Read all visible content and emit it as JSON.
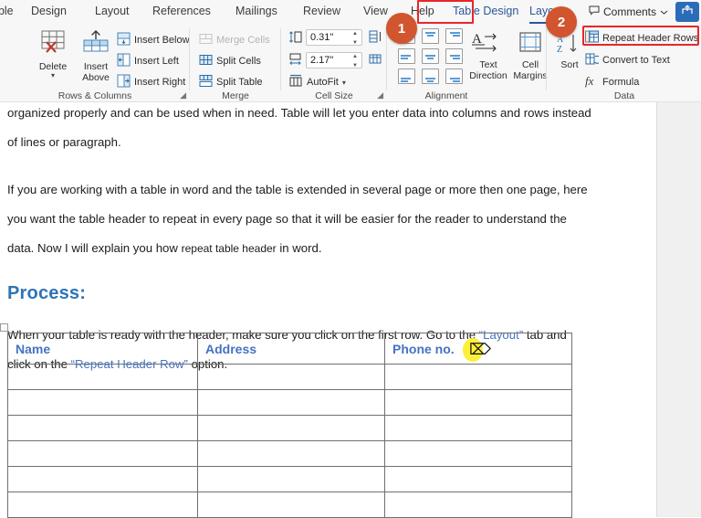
{
  "app": {
    "tabs": [
      {
        "label": "able",
        "state": "cut-off"
      },
      {
        "label": "Design",
        "state": "normal"
      },
      {
        "label": "Layout",
        "state": "normal"
      },
      {
        "label": "References",
        "state": "normal"
      },
      {
        "label": "Mailings",
        "state": "normal"
      },
      {
        "label": "Review",
        "state": "normal"
      },
      {
        "label": "View",
        "state": "normal"
      },
      {
        "label": "Help",
        "state": "normal"
      },
      {
        "label": "Table Design",
        "state": "contextual"
      },
      {
        "label": "Layout",
        "state": "active"
      }
    ],
    "comments_label": "Comments",
    "share_icon": "share-icon",
    "comments_icon": "comment-bubble-icon",
    "chevron_icon": "chevron-down-icon"
  },
  "ribbon": {
    "groups": [
      {
        "name": "Rows & Columns",
        "label": "Rows & Columns",
        "big_buttons": [
          {
            "label_line1": "Delete",
            "label_line2": "",
            "icon": "delete-table-icon",
            "has_dropdown": true
          },
          {
            "label_line1": "Insert",
            "label_line2": "Above",
            "icon": "insert-above-icon",
            "has_dropdown": false
          }
        ],
        "small_buttons": [
          {
            "label": "Insert Below",
            "icon": "insert-below-icon",
            "disabled": false
          },
          {
            "label": "Insert Left",
            "icon": "insert-left-icon",
            "disabled": false
          },
          {
            "label": "Insert Right",
            "icon": "insert-right-icon",
            "disabled": false
          }
        ],
        "launcher": true
      },
      {
        "name": "Merge",
        "label": "Merge",
        "small_buttons": [
          {
            "label": "Merge Cells",
            "icon": "merge-cells-icon",
            "disabled": true
          },
          {
            "label": "Split Cells",
            "icon": "split-cells-icon",
            "disabled": false
          },
          {
            "label": "Split Table",
            "icon": "split-table-icon",
            "disabled": false
          }
        ],
        "launcher": false
      },
      {
        "name": "Cell Size",
        "label": "Cell Size",
        "height_value": "0.31\"",
        "width_value": "2.17\"",
        "autofit_label": "AutoFit",
        "height_icon": "table-row-height-icon",
        "width_icon": "table-column-width-icon",
        "distribute_rows_icon": "distribute-rows-icon",
        "distribute_cols_icon": "distribute-columns-icon",
        "autofit_icon": "autofit-icon",
        "launcher": true
      },
      {
        "name": "Alignment",
        "label": "Alignment",
        "align_buttons": [
          "align-top-left",
          "align-top-center",
          "align-top-right",
          "align-middle-left",
          "align-middle-center",
          "align-middle-right",
          "align-bottom-left",
          "align-bottom-center",
          "align-bottom-right"
        ],
        "text_direction_label_line1": "Text",
        "text_direction_label_line2": "Direction",
        "text_direction_icon": "text-direction-icon",
        "cell_margins_label_line1": "Cell",
        "cell_margins_label_line2": "Margins",
        "cell_margins_icon": "cell-margins-icon",
        "launcher": false
      },
      {
        "name": "Data",
        "label": "Data",
        "sort_label": "Sort",
        "sort_icon": "sort-az-icon",
        "small_buttons": [
          {
            "label": "Repeat Header Rows",
            "icon": "repeat-header-rows-icon",
            "highlighted": true
          },
          {
            "label": "Convert to Text",
            "icon": "convert-to-text-icon",
            "highlighted": false
          },
          {
            "label": "Formula",
            "icon": "formula-fx-icon",
            "highlighted": false
          }
        ],
        "launcher": false
      }
    ]
  },
  "annotations": {
    "badges": [
      {
        "number": "1",
        "target": "layout-tab"
      },
      {
        "number": "2",
        "target": "repeat-header-rows-button"
      }
    ],
    "highlight_color": "#e8262a",
    "badge_color": "#d1552e",
    "cursor_highlight_color": "#fdf03a"
  },
  "document": {
    "paragraphs": [
      {
        "id": "p1",
        "runs": [
          {
            "text": "organized properly and can be used when in need.  Table will let you enter data into columns and rows instead of lines or paragraph.",
            "style": "normal"
          }
        ]
      },
      {
        "id": "p2",
        "runs": [
          {
            "text": "If you are working with a table in word and the table is extended in several page or more then one page, here you want the table header to repeat in every page so that it will be easier for the reader to understand the data.  Now I will explain you how ",
            "style": "normal"
          },
          {
            "text": "repeat table header",
            "style": "small"
          },
          {
            "text": " in word.",
            "style": "normal"
          }
        ]
      }
    ],
    "heading": "Process:",
    "instruction": {
      "runs": [
        {
          "text": "When your table is ready with the header, make sure you click on the first row. Go to the ",
          "style": "normal"
        },
        {
          "text": "“Layout”",
          "style": "blue"
        },
        {
          "text": " tab and click on the ",
          "style": "normal"
        },
        {
          "text": "“Repeat Header Row”",
          "style": "blue"
        },
        {
          "text": " option.",
          "style": "normal"
        }
      ]
    },
    "table": {
      "headers": [
        "Name",
        "Address",
        "Phone no."
      ],
      "empty_row_count": 6
    }
  }
}
